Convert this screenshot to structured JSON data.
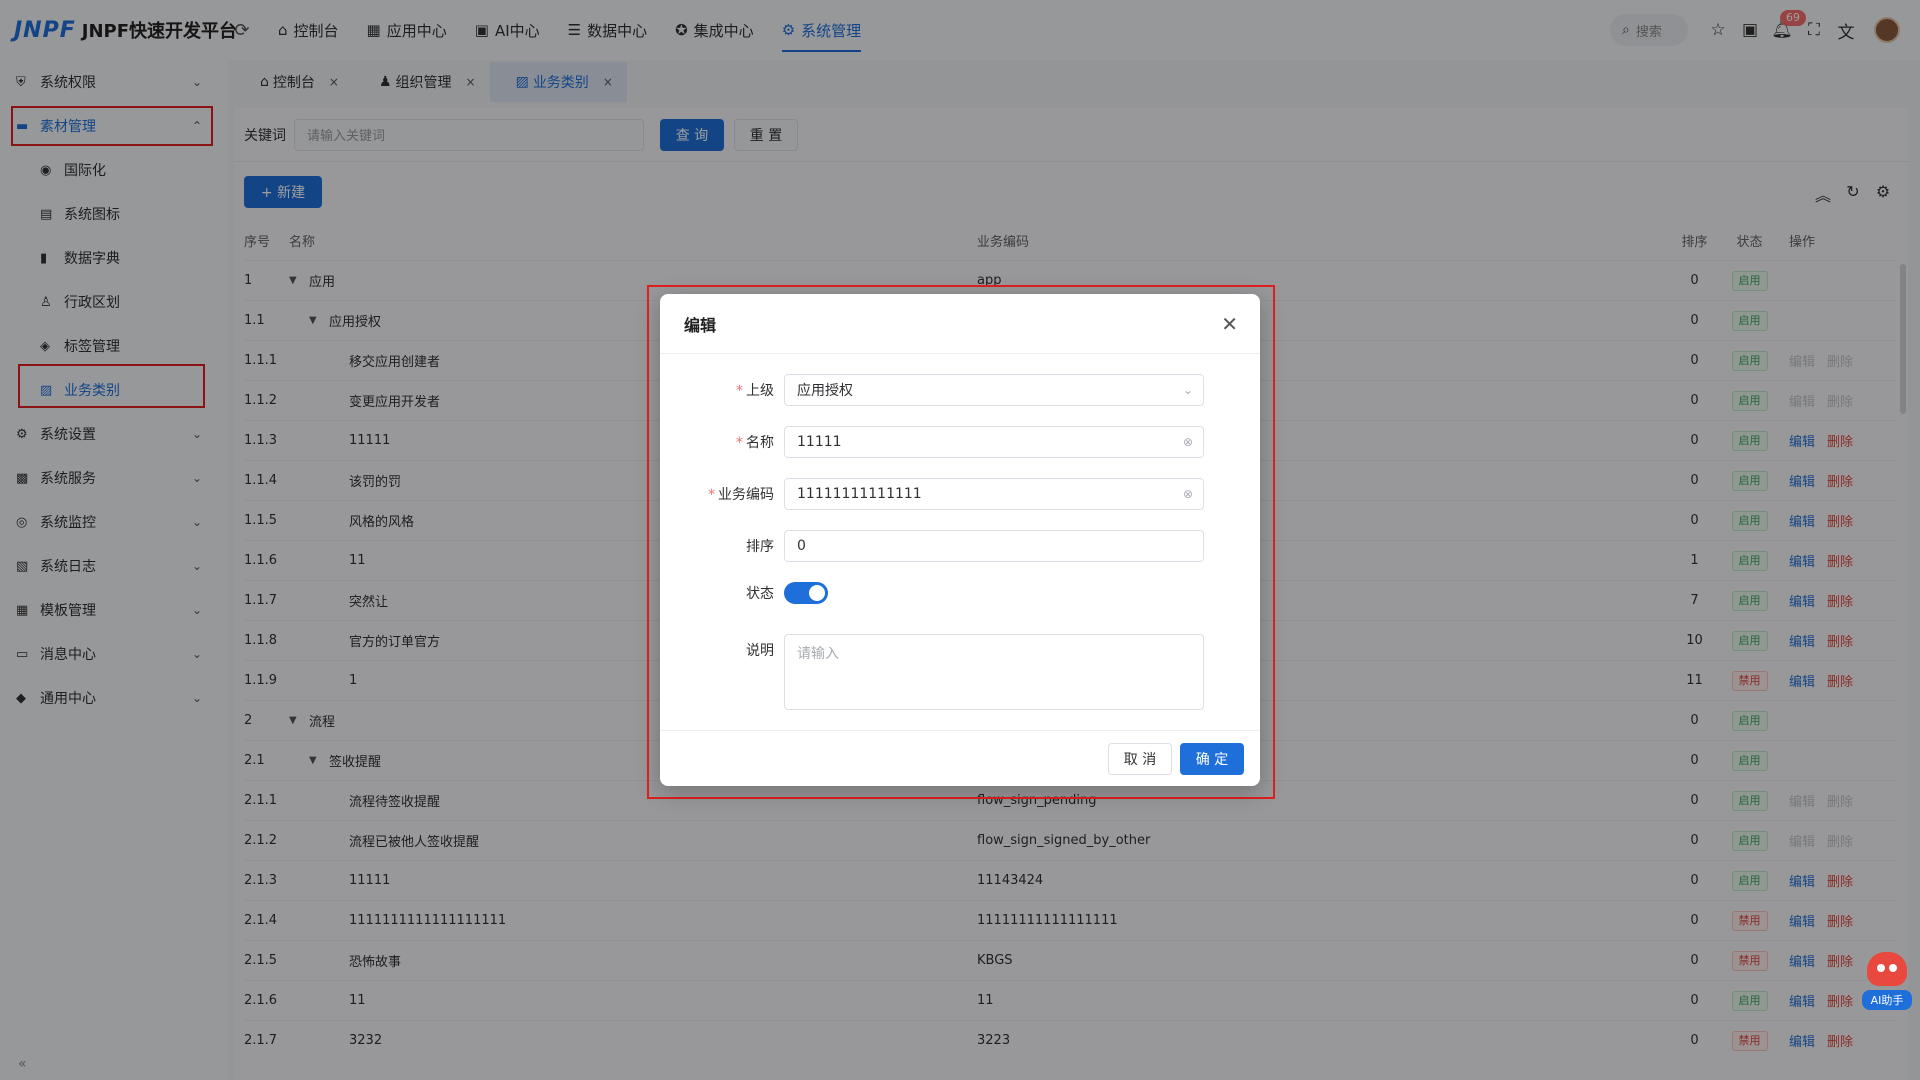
{
  "app": {
    "logo": "JNPF",
    "title": "JNPF快速开发平台"
  },
  "topnav": [
    {
      "icon": "⌂",
      "label": "控制台"
    },
    {
      "icon": "▦",
      "label": "应用中心"
    },
    {
      "icon": "▣",
      "label": "AI中心"
    },
    {
      "icon": "☰",
      "label": "数据中心"
    },
    {
      "icon": "✪",
      "label": "集成中心"
    },
    {
      "icon": "⚙",
      "label": "系统管理"
    }
  ],
  "topright": {
    "search_placeholder": "搜索",
    "notification_count": "69"
  },
  "sidebar": {
    "items": [
      {
        "icon": "⛨",
        "label": "系统权限"
      },
      {
        "icon": "▬",
        "label": "素材管理"
      }
    ],
    "sub": [
      {
        "icon": "◉",
        "label": "国际化"
      },
      {
        "icon": "▤",
        "label": "系统图标"
      },
      {
        "icon": "▮",
        "label": "数据字典"
      },
      {
        "icon": "♙",
        "label": "行政区划"
      },
      {
        "icon": "◈",
        "label": "标签管理"
      },
      {
        "icon": "▨",
        "label": "业务类别"
      }
    ],
    "rest": [
      {
        "icon": "⚙",
        "label": "系统设置"
      },
      {
        "icon": "▩",
        "label": "系统服务"
      },
      {
        "icon": "◎",
        "label": "系统监控"
      },
      {
        "icon": "▧",
        "label": "系统日志"
      },
      {
        "icon": "▦",
        "label": "模板管理"
      },
      {
        "icon": "▭",
        "label": "消息中心"
      },
      {
        "icon": "◆",
        "label": "通用中心"
      }
    ]
  },
  "tabs": [
    {
      "icon": "⌂",
      "label": "控制台"
    },
    {
      "icon": "♟",
      "label": "组织管理"
    },
    {
      "icon": "▨",
      "label": "业务类别"
    }
  ],
  "filter": {
    "keyword_label": "关键词",
    "keyword_placeholder": "请输入关键词",
    "query": "查 询",
    "reset": "重 置"
  },
  "toolbar": {
    "new": "+ 新建"
  },
  "table": {
    "headers": {
      "idx": "序号",
      "name": "名称",
      "code": "业务编码",
      "sort": "排序",
      "status": "状态",
      "ops": "操作"
    },
    "edit": "编辑",
    "delete": "删除",
    "rows": [
      {
        "idx": "1",
        "name": "应用",
        "code": "app",
        "sort": "0",
        "status": "启用",
        "level": 0,
        "caret": true,
        "ops": "none"
      },
      {
        "idx": "1.1",
        "name": "应用授权",
        "code": "",
        "sort": "0",
        "status": "启用",
        "level": 1,
        "caret": true,
        "ops": "none"
      },
      {
        "idx": "1.1.1",
        "name": "移交应用创建者",
        "code": "",
        "sort": "0",
        "status": "启用",
        "level": 2,
        "caret": false,
        "ops": "disabled"
      },
      {
        "idx": "1.1.2",
        "name": "变更应用开发者",
        "code": "",
        "sort": "0",
        "status": "启用",
        "level": 2,
        "caret": false,
        "ops": "disabled"
      },
      {
        "idx": "1.1.3",
        "name": "11111",
        "code": "",
        "sort": "0",
        "status": "启用",
        "level": 2,
        "caret": false,
        "ops": "active"
      },
      {
        "idx": "1.1.4",
        "name": "该罚的罚",
        "code": "",
        "sort": "0",
        "status": "启用",
        "level": 2,
        "caret": false,
        "ops": "active"
      },
      {
        "idx": "1.1.5",
        "name": "风格的风格",
        "code": "",
        "sort": "0",
        "status": "启用",
        "level": 2,
        "caret": false,
        "ops": "active"
      },
      {
        "idx": "1.1.6",
        "name": "11",
        "code": "",
        "sort": "1",
        "status": "启用",
        "level": 2,
        "caret": false,
        "ops": "active"
      },
      {
        "idx": "1.1.7",
        "name": "突然让",
        "code": "",
        "sort": "7",
        "status": "启用",
        "level": 2,
        "caret": false,
        "ops": "active"
      },
      {
        "idx": "1.1.8",
        "name": "官方的订单官方",
        "code": "",
        "sort": "10",
        "status": "启用",
        "level": 2,
        "caret": false,
        "ops": "active"
      },
      {
        "idx": "1.1.9",
        "name": "1",
        "code": "",
        "sort": "11",
        "status": "禁用",
        "level": 2,
        "caret": false,
        "ops": "active"
      },
      {
        "idx": "2",
        "name": "流程",
        "code": "",
        "sort": "0",
        "status": "启用",
        "level": 0,
        "caret": true,
        "ops": "none"
      },
      {
        "idx": "2.1",
        "name": "签收提醒",
        "code": "",
        "sort": "0",
        "status": "启用",
        "level": 1,
        "caret": true,
        "ops": "none"
      },
      {
        "idx": "2.1.1",
        "name": "流程待签收提醒",
        "code": "flow_sign_pending",
        "sort": "0",
        "status": "启用",
        "level": 2,
        "caret": false,
        "ops": "disabled"
      },
      {
        "idx": "2.1.2",
        "name": "流程已被他人签收提醒",
        "code": "flow_sign_signed_by_other",
        "sort": "0",
        "status": "启用",
        "level": 2,
        "caret": false,
        "ops": "disabled"
      },
      {
        "idx": "2.1.3",
        "name": "11111",
        "code": "11143424",
        "sort": "0",
        "status": "启用",
        "level": 2,
        "caret": false,
        "ops": "active"
      },
      {
        "idx": "2.1.4",
        "name": "1111111111111111111",
        "code": "11111111111111111",
        "sort": "0",
        "status": "禁用",
        "level": 2,
        "caret": false,
        "ops": "active"
      },
      {
        "idx": "2.1.5",
        "name": "恐怖故事",
        "code": "KBGS",
        "sort": "0",
        "status": "禁用",
        "level": 2,
        "caret": false,
        "ops": "active"
      },
      {
        "idx": "2.1.6",
        "name": "11",
        "code": "11",
        "sort": "0",
        "status": "启用",
        "level": 2,
        "caret": false,
        "ops": "active"
      },
      {
        "idx": "2.1.7",
        "name": "3232",
        "code": "3223",
        "sort": "0",
        "status": "禁用",
        "level": 2,
        "caret": false,
        "ops": "active"
      }
    ]
  },
  "modal": {
    "title": "编辑",
    "fields": {
      "parent_label": "上级",
      "parent_value": "应用授权",
      "name_label": "名称",
      "name_value": "11111",
      "code_label": "业务编码",
      "code_value": "11111111111111",
      "sort_label": "排序",
      "sort_value": "0",
      "status_label": "状态",
      "status_on": true,
      "desc_label": "说明",
      "desc_placeholder": "请输入"
    },
    "cancel": "取 消",
    "ok": "确 定"
  },
  "ai_helper": {
    "label": "AI助手"
  },
  "colors": {
    "primary": "#1e6fd9",
    "danger": "#e0453c",
    "success": "#3ba55c",
    "highlight_box": "#e02020"
  }
}
